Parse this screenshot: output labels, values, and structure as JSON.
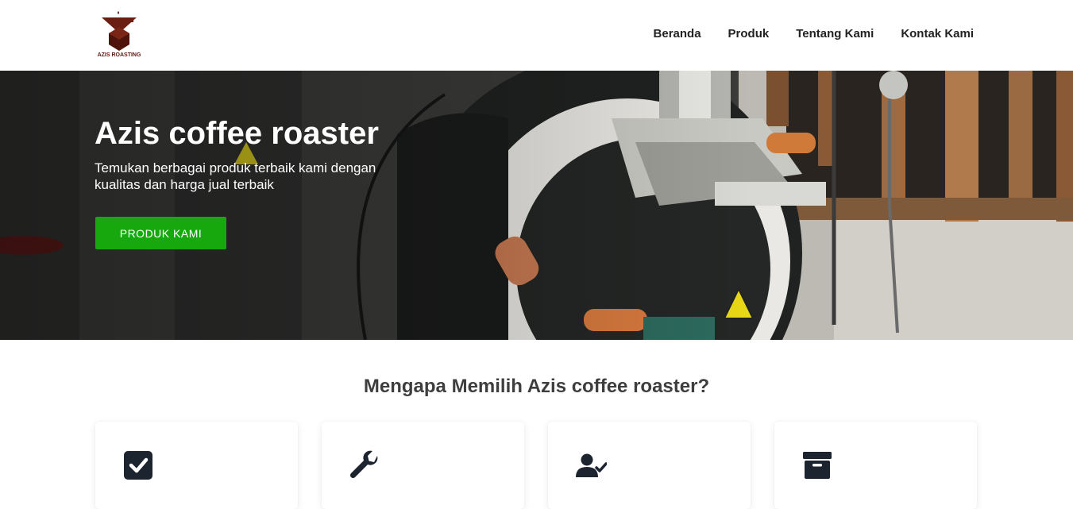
{
  "brand": {
    "logo_text": "AZIS ROASTING",
    "logo_color": "#5a1a10"
  },
  "nav": {
    "items": [
      {
        "label": "Beranda"
      },
      {
        "label": "Produk"
      },
      {
        "label": "Tentang Kami"
      },
      {
        "label": "Kontak Kami"
      }
    ]
  },
  "hero": {
    "title": "Azis coffee roaster",
    "subtitle": "Temukan berbagai produk terbaik kami dengan kualitas dan harga jual terbaik",
    "button_label": "PRODUK KAMI",
    "button_color": "#16a80d"
  },
  "features": {
    "title": "Mengapa Memilih Azis coffee roaster?",
    "cards": [
      {
        "icon": "checkbox-icon"
      },
      {
        "icon": "wrench-icon"
      },
      {
        "icon": "user-check-icon"
      },
      {
        "icon": "archive-box-icon"
      }
    ]
  }
}
